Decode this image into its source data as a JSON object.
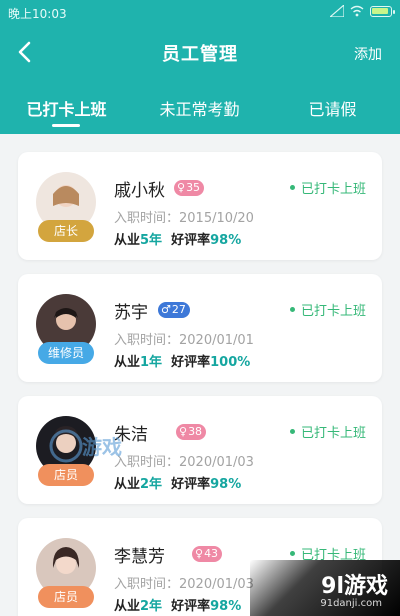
{
  "statusbar": {
    "time": "晚上10:03"
  },
  "header": {
    "title": "员工管理",
    "add_label": "添加"
  },
  "tabs": [
    {
      "label": "已打卡上班",
      "active": true
    },
    {
      "label": "未正常考勤",
      "active": false
    },
    {
      "label": "已请假",
      "active": false
    }
  ],
  "employees": [
    {
      "name": "戚小秋",
      "gender": "female",
      "gender_symbol": "♀",
      "age": "35",
      "role": "店长",
      "status": "已打卡上班",
      "joined": "入职时间：2015/10/20",
      "years_prefix": "从业",
      "years": "5年",
      "rating_prefix": "好评率",
      "rating": "98%"
    },
    {
      "name": "苏宇",
      "gender": "male",
      "gender_symbol": "♂",
      "age": "27",
      "role": "维修员",
      "status": "已打卡上班",
      "joined": "入职时间：2020/01/01",
      "years_prefix": "从业",
      "years": "1年",
      "rating_prefix": "好评率",
      "rating": "100%"
    },
    {
      "name": "朱洁",
      "gender": "female",
      "gender_symbol": "♀",
      "age": "38",
      "role": "店员",
      "status": "已打卡上班",
      "joined": "入职时间：2020/01/03",
      "years_prefix": "从业",
      "years": "2年",
      "rating_prefix": "好评率",
      "rating": "98%"
    },
    {
      "name": "李慧芳",
      "gender": "female",
      "gender_symbol": "♀",
      "age": "43",
      "role": "店员",
      "status": "已打卡上班",
      "joined": "入职时间：2020/01/03",
      "years_prefix": "从业",
      "years": "2年",
      "rating_prefix": "好评率",
      "rating": "98%"
    }
  ],
  "watermarks": {
    "overlay_text": "游戏",
    "corner_brand": "9l游戏",
    "corner_url": "91danji.com"
  },
  "colors": {
    "primary": "#1fb3ad",
    "status_green": "#36b878",
    "highlight": "#15a6a0",
    "female_badge": "#ef89a5",
    "male_badge": "#3d78d8"
  }
}
